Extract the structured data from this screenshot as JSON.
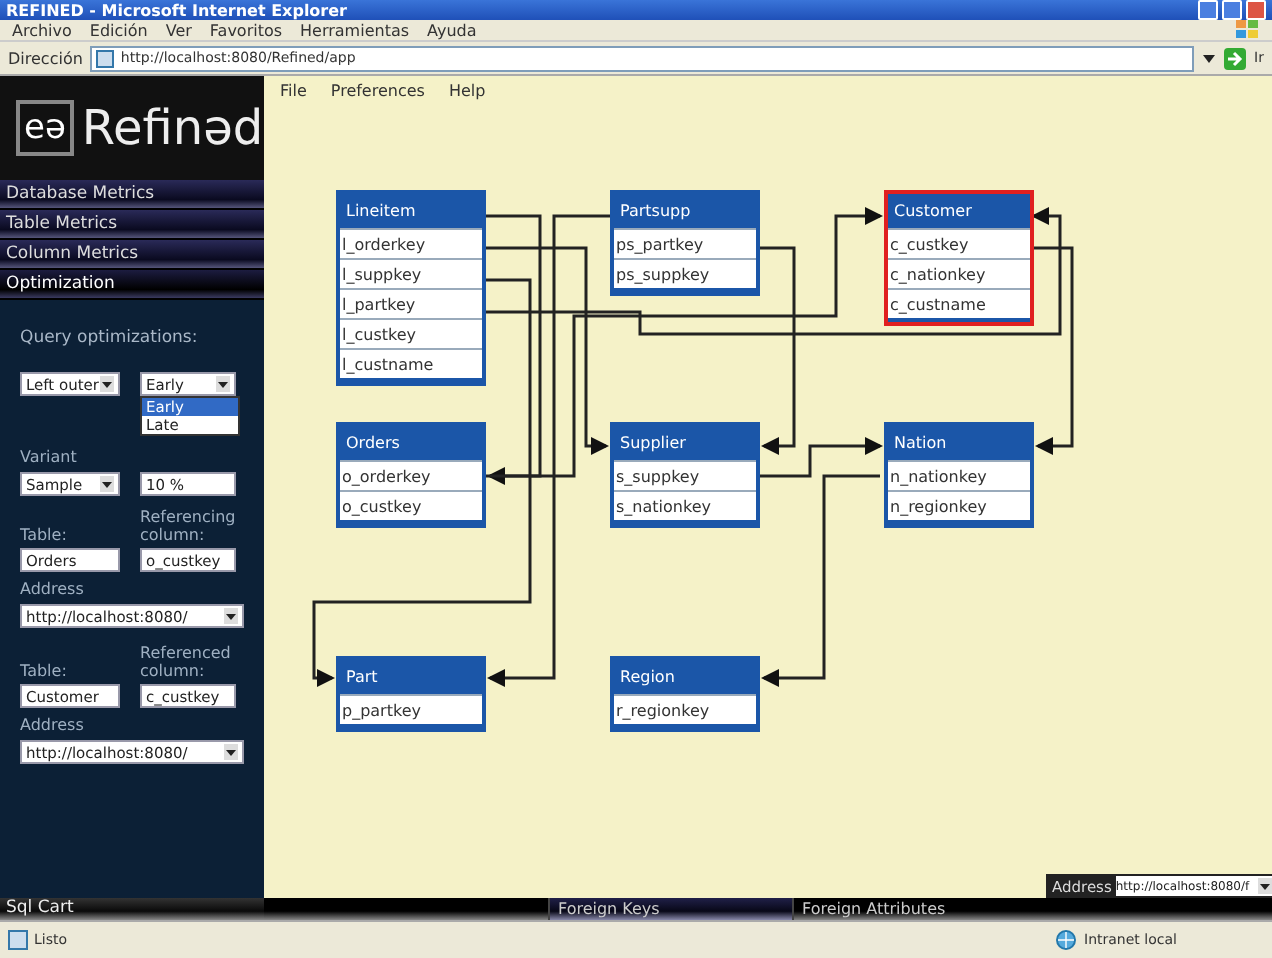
{
  "window": {
    "title": "REFINED - Microsoft Internet Explorer"
  },
  "browser_menu": [
    "Archivo",
    "Edición",
    "Ver",
    "Favoritos",
    "Herramientas",
    "Ayuda"
  ],
  "address_bar": {
    "label": "Dirección",
    "value": "http://localhost:8080/Refined/app",
    "go": "Ir"
  },
  "app_menu": [
    "File",
    "Preferences",
    "Help"
  ],
  "logo": {
    "mark": "eə",
    "text": "Refinəd"
  },
  "sidebar": {
    "items": [
      {
        "label": "Database Metrics",
        "selected": false
      },
      {
        "label": "Table Metrics",
        "selected": false
      },
      {
        "label": "Column Metrics",
        "selected": false
      },
      {
        "label": "Optimization",
        "selected": true
      }
    ],
    "panel": {
      "heading": "Query optimizations:",
      "join": {
        "value": "Left outer"
      },
      "timing": {
        "value": "Early",
        "expanded": true,
        "options": [
          {
            "label": "Early",
            "selected": true
          },
          {
            "label": "Late",
            "selected": false
          }
        ]
      },
      "variant_label": "Variant",
      "variant": {
        "value": "Sample"
      },
      "ratio": {
        "value": "10 %"
      },
      "referencing": {
        "table_label": "Table:",
        "column_label": "Referencing column:",
        "table": "Orders",
        "column": "o_custkey",
        "address_label": "Address",
        "address": "http://localhost:8080/"
      },
      "referenced": {
        "table_label": "Table:",
        "column_label": "Referenced column:",
        "table": "Customer",
        "column": "c_custkey",
        "address_label": "Address",
        "address": "http://localhost:8080/"
      }
    },
    "footer": "Sql Cart"
  },
  "diagram": {
    "tables": [
      {
        "name": "Lineitem",
        "selected": false,
        "columns": [
          "l_orderkey",
          "l_suppkey",
          "l_partkey",
          "l_custkey",
          "l_custname"
        ]
      },
      {
        "name": "Partsupp",
        "selected": false,
        "columns": [
          "ps_partkey",
          "ps_suppkey"
        ]
      },
      {
        "name": "Customer",
        "selected": true,
        "columns": [
          "c_custkey",
          "c_nationkey",
          "c_custname"
        ]
      },
      {
        "name": "Orders",
        "selected": false,
        "columns": [
          "o_orderkey",
          "o_custkey"
        ]
      },
      {
        "name": "Supplier",
        "selected": false,
        "columns": [
          "s_suppkey",
          "s_nationkey"
        ]
      },
      {
        "name": "Nation",
        "selected": false,
        "columns": [
          "n_nationkey",
          "n_regionkey"
        ]
      },
      {
        "name": "Part",
        "selected": false,
        "columns": [
          "p_partkey"
        ]
      },
      {
        "name": "Region",
        "selected": false,
        "columns": [
          "r_regionkey"
        ]
      }
    ]
  },
  "bottom_address": {
    "label": "Address",
    "value": "http://localhost:8080/f"
  },
  "bottom_tabs": [
    {
      "label": "Foreign Keys",
      "selected": true
    },
    {
      "label": "Foreign Attributes",
      "selected": false
    }
  ],
  "status_bar": {
    "left": "Listo",
    "zone": "Intranet local"
  }
}
